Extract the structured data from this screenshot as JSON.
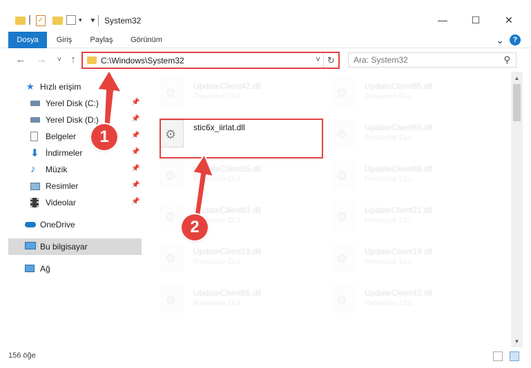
{
  "window": {
    "title": "System32",
    "minimize": "—",
    "maximize": "☐",
    "close": "✕"
  },
  "ribbon": {
    "tabs": [
      "Dosya",
      "Giriş",
      "Paylaş",
      "Görünüm"
    ],
    "expand": "⌄",
    "help": "?"
  },
  "nav": {
    "back": "←",
    "forward": "→",
    "recent": "˅",
    "up": "↑"
  },
  "address": {
    "path": "C:\\Windows\\System32",
    "dropdown": "˅",
    "refresh": "↻"
  },
  "search": {
    "placeholder": "Ara: System32",
    "icon": "⚲"
  },
  "sidebar": {
    "items": [
      {
        "label": "Hızlı erişim",
        "icon": "star-icon"
      },
      {
        "label": "Yerel Disk (C:)",
        "icon": "drive-icon",
        "pinned": true
      },
      {
        "label": "Yerel Disk (D:)",
        "icon": "drive-icon",
        "pinned": true
      },
      {
        "label": "Belgeler",
        "icon": "documents-icon",
        "pinned": true
      },
      {
        "label": "İndirmeler",
        "icon": "download-icon",
        "pinned": true
      },
      {
        "label": "Müzik",
        "icon": "music-icon",
        "pinned": true
      },
      {
        "label": "Resimler",
        "icon": "pictures-icon",
        "pinned": true
      },
      {
        "label": "Videolar",
        "icon": "videos-icon",
        "pinned": true
      },
      {
        "label": "OneDrive",
        "icon": "cloud-icon"
      },
      {
        "label": "Bu bilgisayar",
        "icon": "computer-icon"
      },
      {
        "label": "Ağ",
        "icon": "network-icon"
      }
    ]
  },
  "files": {
    "left": [
      {
        "name": "UpdateClient42.dll",
        "type": "Resource DLL"
      },
      {
        "name": "stic6x_iirlat.dll",
        "type": ""
      },
      {
        "name": "UpdateClient65.dll",
        "type": "Resource DLL"
      },
      {
        "name": "UpdateClient63.dll",
        "type": "Resource DLL"
      },
      {
        "name": "UpdateClient19.dll",
        "type": "Resource DLL"
      },
      {
        "name": "UpdateClient65.dll",
        "type": "Resource DLL"
      }
    ],
    "right": [
      {
        "name": "UpdateClient65.dll",
        "type": "Resource DLL"
      },
      {
        "name": "UpdateClient65.dll",
        "type": "Resource DLL"
      },
      {
        "name": "UpdateClient65.dll",
        "type": "Resource DLL"
      },
      {
        "name": "UpdateClient21.dll",
        "type": "Resource DLL"
      },
      {
        "name": "UpdateClient19.dll",
        "type": "Resource DLL"
      },
      {
        "name": "UpdateClient42.dll",
        "type": "Resource DLL"
      }
    ]
  },
  "status": {
    "count": "156 öğe"
  },
  "annotations": {
    "step1": "1",
    "step2": "2",
    "color": "#e6423d"
  },
  "colors": {
    "accent": "#1979ca",
    "highlight": "#e24242",
    "folder": "#f3c850"
  }
}
